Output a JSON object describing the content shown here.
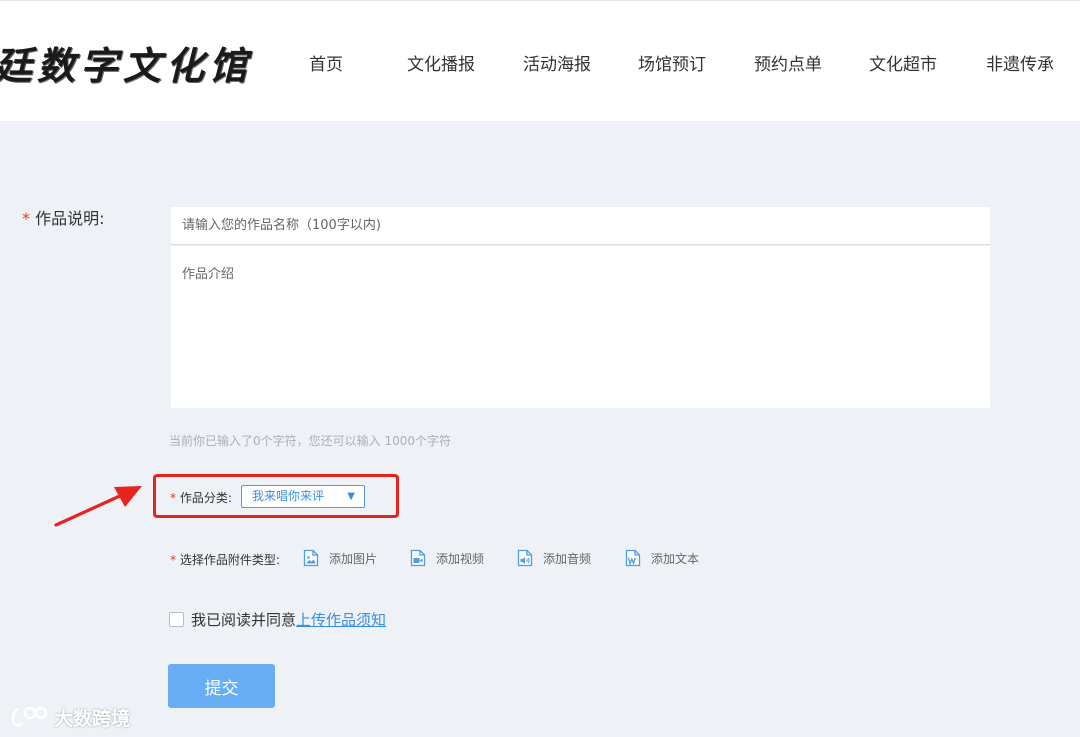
{
  "header": {
    "logo_text": "廷数字文化馆",
    "nav": [
      "首页",
      "文化播报",
      "活动海报",
      "场馆预订",
      "预约点单",
      "文化超市",
      "非遗传承"
    ]
  },
  "form": {
    "required_mark": "*",
    "desc_label": "作品说明:",
    "title_placeholder": "请输入您的作品名称（100字以内)",
    "title_value": "",
    "intro_placeholder": "作品介绍",
    "intro_value": "",
    "counter_text": "当前你已输入了0个字符，您还可以输入 1000个字符",
    "category_label": "作品分类:",
    "category_value": "我来唱你来评",
    "caret": "▼",
    "attachment_label": "选择作品附件类型:",
    "attachments": [
      {
        "label": "添加图片",
        "icon": "image-file-icon"
      },
      {
        "label": "添加视频",
        "icon": "video-file-icon"
      },
      {
        "label": "添加音频",
        "icon": "audio-file-icon"
      },
      {
        "label": "添加文本",
        "icon": "word-file-icon"
      }
    ],
    "agree_text": "我已阅读并同意",
    "agree_link": "上传作品须知",
    "submit_label": "提交"
  },
  "annotation": {
    "highlight_color": "#e8231e"
  },
  "watermark": {
    "text": "大数跨境"
  },
  "colors": {
    "accent": "#3a8ee6",
    "submit_bg": "#67aef4",
    "required": "#e8381f",
    "page_bg": "#eef1f5"
  }
}
